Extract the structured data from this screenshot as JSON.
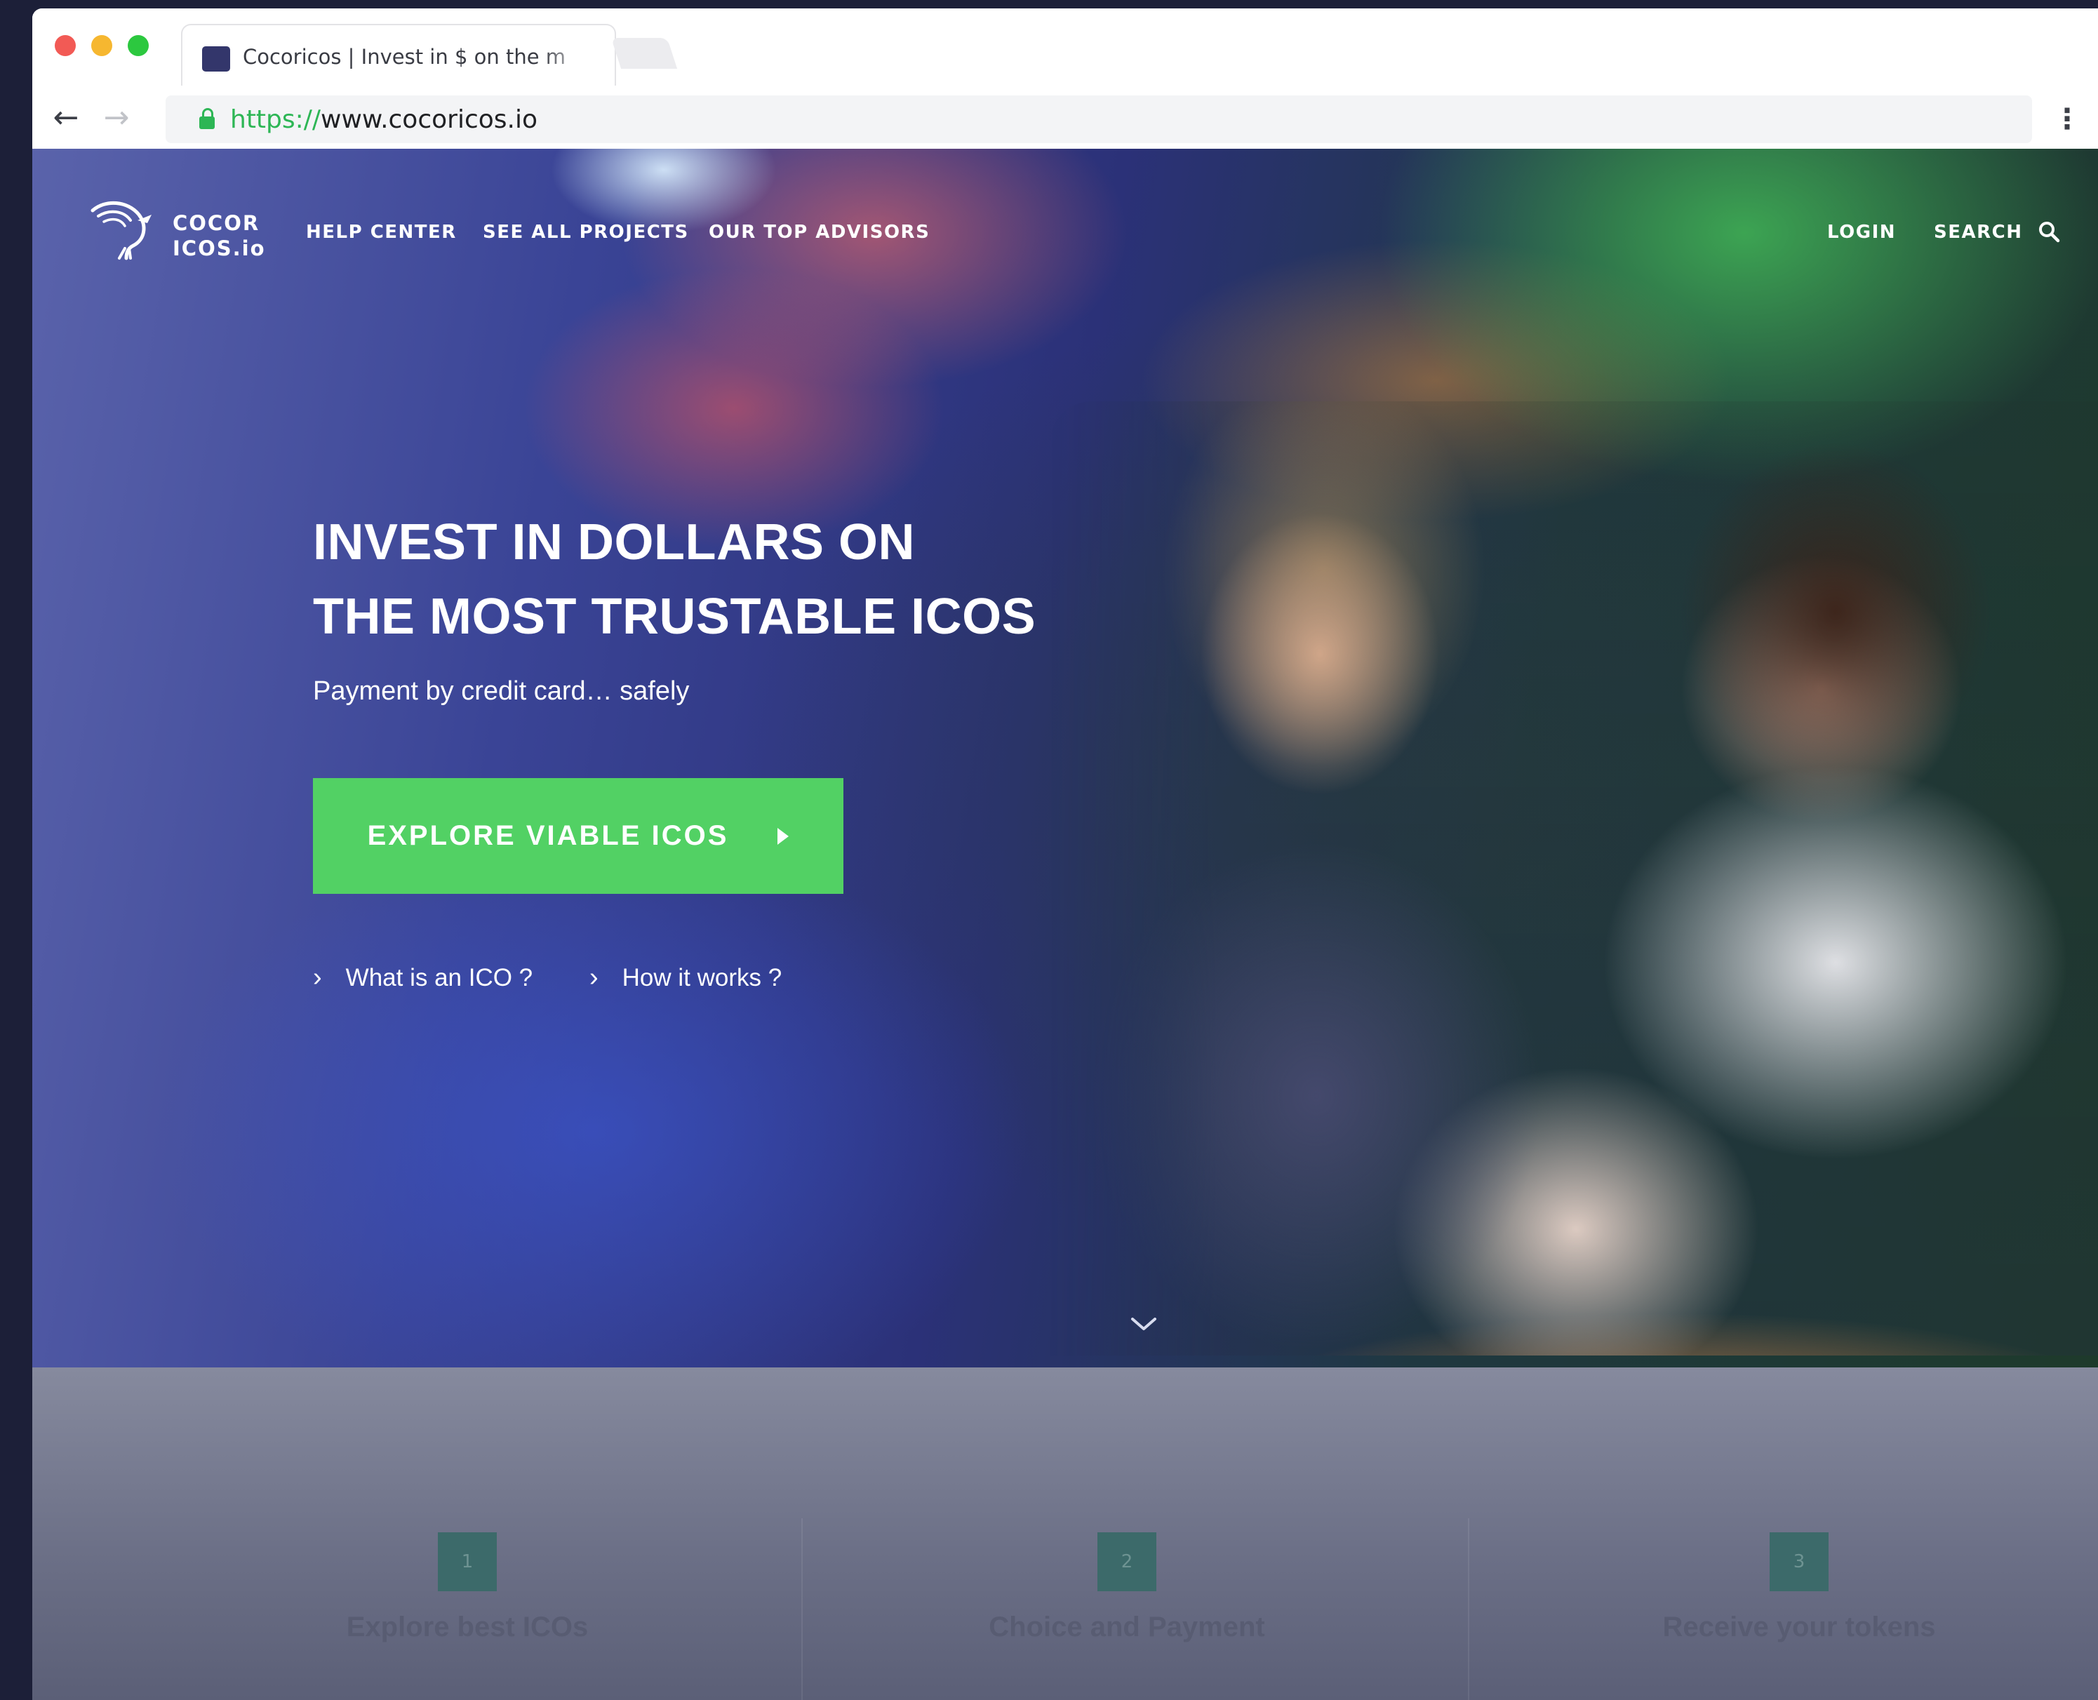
{
  "browser": {
    "tab_title": "Cocoricos | Invest in $ on the m",
    "url_scheme": "https://",
    "url_host": "www.cocoricos.io"
  },
  "site": {
    "logo_line1": "COCOR",
    "logo_line2": "ICOS.io",
    "nav": {
      "help_center": "HELP CENTER",
      "all_projects": "SEE ALL PROJECTS",
      "top_advisors": "OUR TOP ADVISORS",
      "login": "LOGIN",
      "search": "SEARCH"
    }
  },
  "hero": {
    "title_line1": "INVEST IN DOLLARS ON",
    "title_line2": "THE MOST TRUSTABLE ICOS",
    "subtitle": "Payment by credit card… safely",
    "cta_label": "EXPLORE VIABLE ICOS",
    "link_what_is": "What is an ICO ?",
    "link_how_it_works": "How it works ?"
  },
  "steps": [
    {
      "number": "1",
      "label": "Explore best ICOs"
    },
    {
      "number": "2",
      "label": "Choice and Payment"
    },
    {
      "number": "3",
      "label": "Receive your tokens"
    }
  ],
  "colors": {
    "cta_green": "#52d164",
    "secure_green": "#2db655",
    "hero_navy": "#2b3178"
  }
}
